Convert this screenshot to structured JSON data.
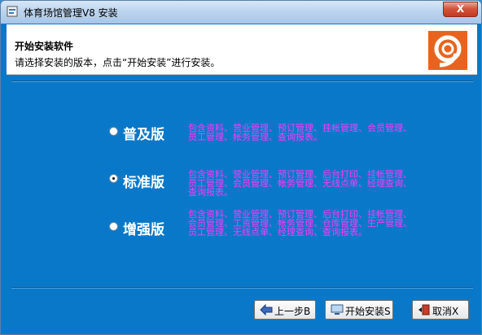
{
  "window": {
    "title": "体育场馆管理V8 安装",
    "close_glyph": "X"
  },
  "header": {
    "title": "开始安装软件",
    "subtitle": "请选择安装的版本，点击“开始安装”进行安装。"
  },
  "options": [
    {
      "label": "普及版",
      "checked": false,
      "lines": [
        "包含资料、营业管理、预订管理、挂帐管理、会员管理、",
        "员工管理、帐务管理、查询报表。"
      ]
    },
    {
      "label": "标准版",
      "checked": true,
      "lines": [
        "包含资料、营业管理、预订管理、后台打印、挂帐管理、",
        "员工管理、会员管理、帐务管理、无线点单、经理查询、",
        "查询报表。"
      ]
    },
    {
      "label": "增强版",
      "checked": false,
      "lines": [
        "包含资料、营业管理、预订管理、后台打印、挂帐管理、",
        "会员管理、工资管理、帐务管理、仓库管理、生产管理、",
        "员工管理、无线点单、经理查询、查询报表。"
      ]
    }
  ],
  "buttons": {
    "back": "上一步B",
    "install": "开始安装S",
    "cancel": "取消X"
  },
  "colors": {
    "background": "#0a78c8",
    "description_text": "#ff38ff",
    "label_text": "#ffffff"
  }
}
